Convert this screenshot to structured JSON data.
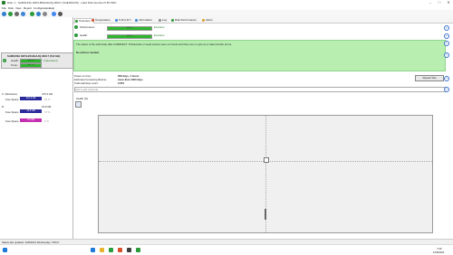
{
  "window": {
    "title": "Disk: 1 - SAMSUNG MZVLB512HAJQ-000L7 (S4ENNX0N) - Hard Disk Sentinel 5.50 PRO",
    "minimize": "–",
    "maximize": "□",
    "close": "✕"
  },
  "menu": [
    "File",
    "Disk",
    "View",
    "Report",
    "Configuration",
    "Help"
  ],
  "toolbar_icons": [
    "refresh-icon",
    "chart-icon",
    "disk-icon",
    "report-icon",
    "settings-icon",
    "globe-icon",
    "lock-icon",
    "help-icon",
    "search-icon"
  ],
  "left": {
    "disk_name": "SAMSUNG MZVLB512HAJQ-000L7 (512 GB)",
    "health_label": "Health:",
    "health_value": "100 %",
    "health_extra": "0 (Excellent)",
    "temp_label": "Temp.:",
    "temp_value": "40 °C",
    "drives": [
      {
        "name": "C: (Windows)",
        "size": "476.3 GB",
        "free_label": "Free Space",
        "free_value": "121.3 GB",
        "pct": "25 %"
      },
      {
        "name": "D:",
        "size": "19.8 GB",
        "free_label": "Free Space",
        "free_value": "14.6 GB",
        "pct": "74 %"
      },
      {
        "name": "",
        "size": "",
        "free_label": "Free Space",
        "free_value": "0.3 GB",
        "pct": "5 %"
      }
    ]
  },
  "tabs": [
    "Overview",
    "Temperature",
    "S.M.A.R.T.",
    "Information",
    "Log",
    "Disk Performance",
    "Alerts"
  ],
  "overview": {
    "performance_label": "Performance:",
    "performance_value": 100,
    "performance_text": "100 %",
    "performance_status": "Excellent",
    "health_label": "Health:",
    "health_value": 100,
    "health_text": "100 %",
    "health_status": "Excellent",
    "message": "The status of the solid state disk is PERFECT. Problematic or weak sectors were not found and there are no spin up or data transfer errors.",
    "actions": "No actions needed.",
    "power_on_label": "Power on time:",
    "power_on_value": "258 days, 1 hours",
    "lifetime_label": "Estimated remaining lifetime:",
    "lifetime_value": "more than 1000 days",
    "starts_label": "Total start/stop count:",
    "starts_value": "3 651",
    "repeat_button": "Repeat Test",
    "comment_placeholder": "Click to add comments"
  },
  "chart_panel": {
    "title": "Health (%)"
  },
  "status": {
    "text": "Status last updated: 12/8/2021 Wednesday 7:08:27"
  },
  "taskbar": {
    "time": "7:09",
    "date": "12/8/2021"
  }
}
